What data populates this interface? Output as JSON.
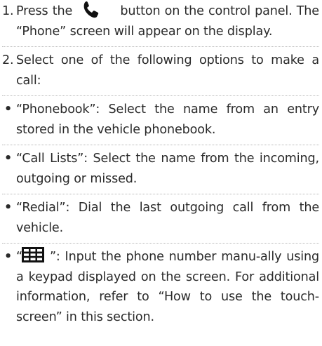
{
  "step1": {
    "number": "1.",
    "text_before": "Press the",
    "icon": "phone-handset-icon",
    "text_after": "button on the control panel. The “Phone” screen will appear on the display."
  },
  "step2": {
    "number": "2.",
    "text": "Select one of the following options to make a call:"
  },
  "bullets": [
    {
      "symbol": "•",
      "text": "“Phonebook”: Select the name from an entry stored in the vehicle phonebook."
    },
    {
      "symbol": "•",
      "text": "“Call Lists”: Select the name from the incoming, outgoing or missed."
    },
    {
      "symbol": "•",
      "text": "“Redial”: Dial the last outgoing call from the vehicle."
    }
  ],
  "keypad_bullet": {
    "symbol": "•",
    "open_quote": "“",
    "icon": "keypad-icon",
    "text": "”: Input the phone number manu-ally using a keypad displayed on the screen. For additional information, refer to “How to use the touch-screen” in this section."
  },
  "colors": {
    "text": "#2a2a2a",
    "divider": "#b8b8b8",
    "icon": "#111111"
  }
}
